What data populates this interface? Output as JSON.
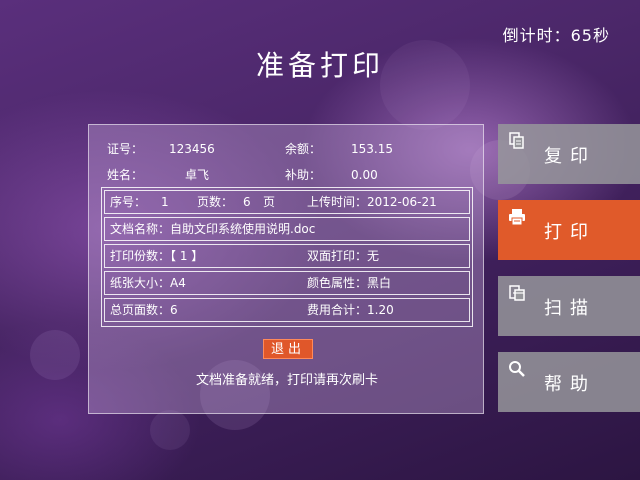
{
  "countdown": "倒计时：65秒",
  "title": "准备打印",
  "info": {
    "card_label": "证号：",
    "card_value": "123456",
    "balance_label": "余额：",
    "balance_value": "153.15",
    "name_label": "姓名：",
    "name_value": "卓飞",
    "subsidy_label": "补助：",
    "subsidy_value": "0.00"
  },
  "rows": {
    "seq_label": "序号：",
    "seq_value": "1",
    "pages_label": "页数：",
    "pages_value": "6",
    "pages_unit": "页",
    "upload_text": "上传时间：2012-06-21",
    "doc_name": "文档名称：自助文印系统使用说明.doc",
    "copies_text": "打印份数：【 1 】",
    "duplex_text": "双面打印：无",
    "paper_text": "纸张大小：A4",
    "color_text": "颜色属性：黑白",
    "total_pages_text": "总页面数：6",
    "total_fee_text": "费用合计：1.20"
  },
  "exit_label": "退出",
  "status_text": "文档准备就绪，打印请再次刷卡",
  "side": {
    "copy": "复印",
    "print": "打印",
    "scan": "扫描",
    "help": "帮助"
  },
  "icons": [
    "copy-icon",
    "printer-icon",
    "scan-icon",
    "magnifier-icon"
  ],
  "colors": {
    "active": "#e05a2a",
    "inactive": "#96969b",
    "exit": "#e0572a"
  }
}
